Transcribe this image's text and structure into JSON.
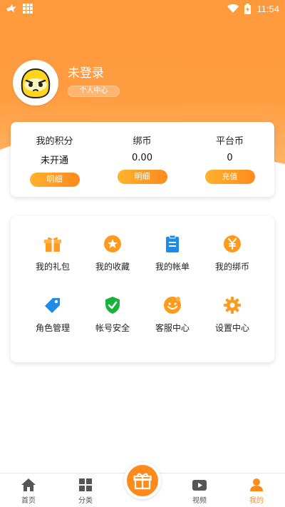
{
  "status_bar": {
    "time": "11:54",
    "icons": [
      "bird-icon",
      "grid-icon",
      "wifi-icon",
      "battery-charging-icon"
    ]
  },
  "profile": {
    "username": "未登录",
    "center_label": "个人中心"
  },
  "points": [
    {
      "label": "我的积分",
      "value": "未开通",
      "button": "明细"
    },
    {
      "label": "绑币",
      "value": "0.00",
      "button": "明细"
    },
    {
      "label": "平台币",
      "value": "0",
      "button": "充值"
    }
  ],
  "menu": [
    {
      "label": "我的礼包",
      "icon": "gift-icon"
    },
    {
      "label": "我的收藏",
      "icon": "star-icon"
    },
    {
      "label": "我的帐单",
      "icon": "bill-icon"
    },
    {
      "label": "我的绑币",
      "icon": "yuan-icon"
    },
    {
      "label": "角色管理",
      "icon": "tag-icon"
    },
    {
      "label": "帐号安全",
      "icon": "shield-icon"
    },
    {
      "label": "客服中心",
      "icon": "smile-icon"
    },
    {
      "label": "设置中心",
      "icon": "gear-icon"
    }
  ],
  "bottom_nav": [
    {
      "label": "首页",
      "icon": "home-icon"
    },
    {
      "label": "分类",
      "icon": "category-icon"
    },
    {
      "label": "视频",
      "icon": "video-icon"
    },
    {
      "label": "我的",
      "icon": "user-icon"
    }
  ],
  "colors": {
    "accent": "#ff8a1c",
    "header": "#ff9a3c",
    "icon_orange": "#ff9a1c",
    "icon_blue": "#1e8be8",
    "icon_green": "#18b33a"
  }
}
